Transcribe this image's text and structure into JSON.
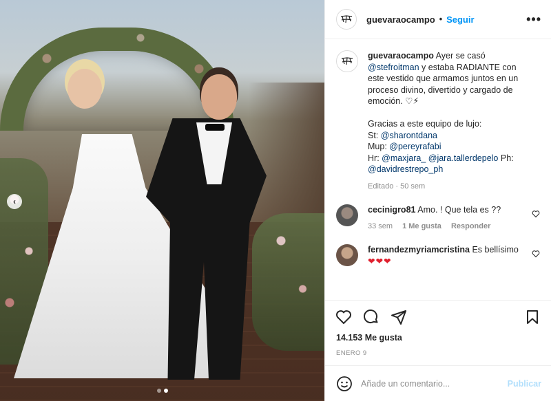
{
  "header": {
    "username": "guevaraocampo",
    "separator": "•",
    "follow_label": "Seguir",
    "more_label": "•••"
  },
  "caption": {
    "username": "guevaraocampo",
    "text_1": "Ayer se casó",
    "mention_1": "@stefroitman",
    "text_2": "y estaba RADIANTE con este vestido que armamos juntos en un proceso divino, divertido y cargado de emoción.",
    "emoji": "♡⚡",
    "thanks": "Gracias a este equipo de lujo:",
    "st_label": "St:",
    "st_mention": "@sharontdana",
    "mup_label": "Mup:",
    "mup_mention": "@pereyrafabi",
    "hr_label": "Hr:",
    "hr_mention_1": "@maxjara_",
    "hr_mention_2": "@jara.tallerdepelo",
    "ph_label": "Ph:",
    "ph_mention": "@davidrestrepo_ph",
    "meta": "Editado · 50 sem"
  },
  "comments": [
    {
      "username": "cecinigro81",
      "text": "Amo. ! Que tela es ??",
      "time": "33 sem",
      "likes": "1 Me gusta",
      "reply": "Responder"
    },
    {
      "username": "fernandezmyriamcristina",
      "text": "Es bellísimo",
      "hearts": "❤❤❤"
    }
  ],
  "likes": "14.153 Me gusta",
  "date": "ENERO 9",
  "add_comment": {
    "placeholder": "Añade un comentario...",
    "publish": "Publicar"
  },
  "carousel": {
    "prev_label": "‹",
    "slides": 2,
    "active": 1
  }
}
